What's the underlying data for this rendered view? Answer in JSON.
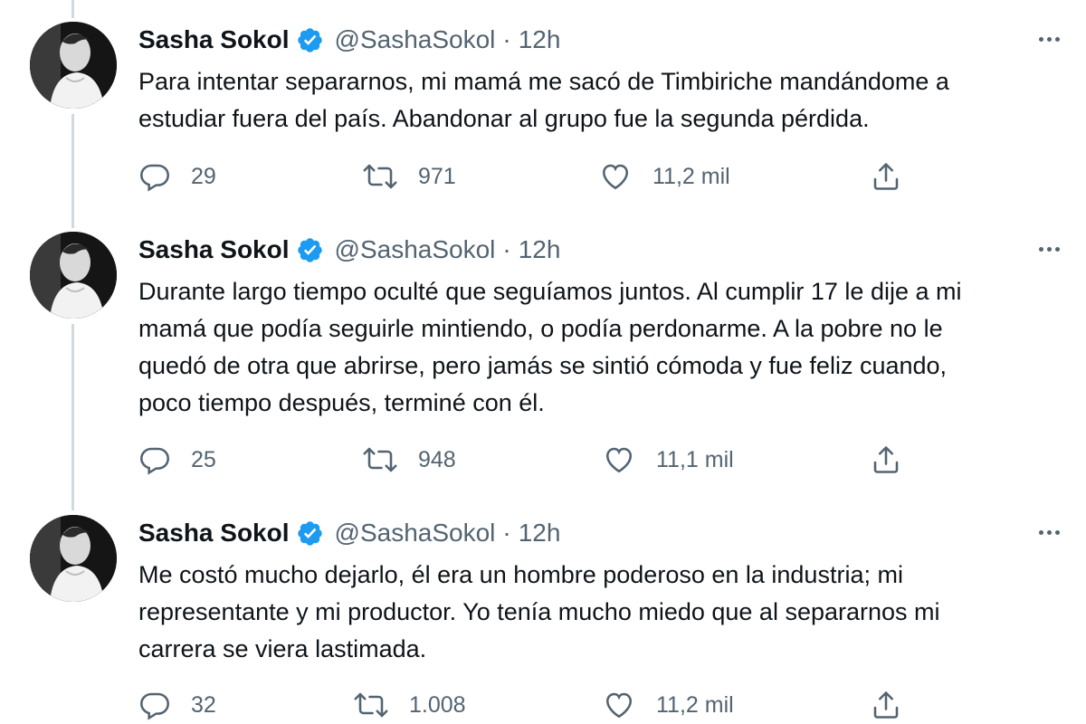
{
  "tweets": [
    {
      "name": "Sasha Sokol",
      "handle": "@SashaSokol",
      "separator": "·",
      "time": "12h",
      "lines": [
        "Para intentar separarnos, mi mamá me sacó de Timbiriche mandándome a",
        "estudiar fuera del país. Abandonar al grupo fue la segunda pérdida."
      ],
      "replies": "29",
      "retweets": "971",
      "likes": "11,2 mil"
    },
    {
      "name": "Sasha Sokol",
      "handle": "@SashaSokol",
      "separator": "·",
      "time": "12h",
      "lines": [
        "Durante largo tiempo oculté que seguíamos juntos. Al cumplir 17 le dije a mi",
        "mamá que podía seguirle mintiendo, o podía perdonarme. A la pobre no le",
        "quedó de otra que abrirse, pero jamás se sintió cómoda y fue feliz cuando,",
        "poco tiempo después, terminé con él."
      ],
      "replies": "25",
      "retweets": "948",
      "likes": "11,1 mil"
    },
    {
      "name": "Sasha Sokol",
      "handle": "@SashaSokol",
      "separator": "·",
      "time": "12h",
      "lines": [
        "Me costó mucho dejarlo, él era un hombre poderoso en la industria; mi",
        "representante y mi productor. Yo tenía mucho miedo que al separarnos mi",
        "carrera se viera lastimada."
      ],
      "replies": "32",
      "retweets": "1.008",
      "likes": "11,2 mil"
    }
  ],
  "icons": {
    "reply": "reply-icon",
    "retweet": "retweet-icon",
    "like": "heart-icon",
    "share": "share-icon",
    "verified": "verified-badge-icon",
    "more": "more-options-icon"
  },
  "colors": {
    "verified": "#1d9bf0",
    "secondary_text": "#536471",
    "thread_line": "#cfd9de"
  }
}
